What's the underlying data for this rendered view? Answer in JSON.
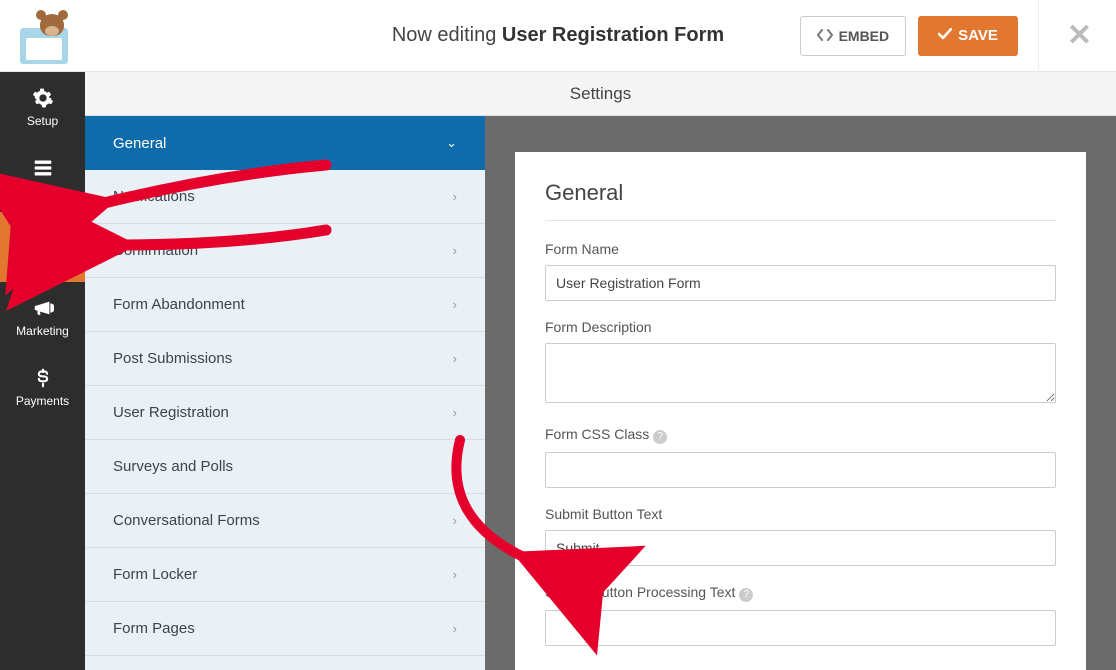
{
  "header": {
    "editing_prefix": "Now editing ",
    "editing_title": "User Registration Form",
    "embed_label": "EMBED",
    "save_label": "SAVE"
  },
  "leftnav": {
    "items": [
      {
        "label": "Setup"
      },
      {
        "label": "Fields"
      },
      {
        "label": "Settings"
      },
      {
        "label": "Marketing"
      },
      {
        "label": "Payments"
      }
    ]
  },
  "section_title": "Settings",
  "settings_menu": {
    "items": [
      {
        "label": "General"
      },
      {
        "label": "Notifications"
      },
      {
        "label": "Confirmation"
      },
      {
        "label": "Form Abandonment"
      },
      {
        "label": "Post Submissions"
      },
      {
        "label": "User Registration"
      },
      {
        "label": "Surveys and Polls"
      },
      {
        "label": "Conversational Forms"
      },
      {
        "label": "Form Locker"
      },
      {
        "label": "Form Pages"
      }
    ]
  },
  "panel": {
    "heading": "General",
    "form_name_label": "Form Name",
    "form_name_value": "User Registration Form",
    "form_description_label": "Form Description",
    "form_description_value": "",
    "form_css_class_label": "Form CSS Class",
    "form_css_class_value": "",
    "submit_button_text_label": "Submit Button Text",
    "submit_button_text_value": "Submit",
    "submit_button_processing_label": "Submit Button Processing Text",
    "submit_button_processing_value": ""
  },
  "colors": {
    "accent": "#e27730",
    "primary": "#0e6cad"
  }
}
